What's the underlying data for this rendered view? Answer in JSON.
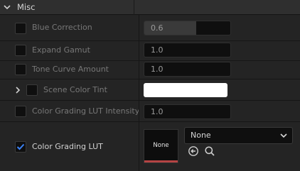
{
  "section": {
    "title": "Misc"
  },
  "rows": [
    {
      "label": "Blue Correction",
      "value": "0.6",
      "slider_fraction": 0.6
    },
    {
      "label": "Expand Gamut",
      "value": "1.0"
    },
    {
      "label": "Tone Curve Amount",
      "value": "1.0"
    },
    {
      "label": "Scene Color Tint",
      "color": "#FFFFFF"
    },
    {
      "label": "Color Grading LUT Intensity",
      "value": "1.0"
    },
    {
      "label": "Color Grading LUT",
      "checked": true,
      "thumbnail_label": "None",
      "asset_value": "None"
    }
  ],
  "icons": {
    "collapse": "chevron-down-icon",
    "expand": "chevron-right-icon",
    "browse": "arrow-left-circle-icon",
    "find": "search-icon",
    "dropdown": "chevron-down-icon"
  },
  "colors": {
    "checkbox_check": "#3b82f6",
    "thumbnail_bar": "#B54444"
  }
}
